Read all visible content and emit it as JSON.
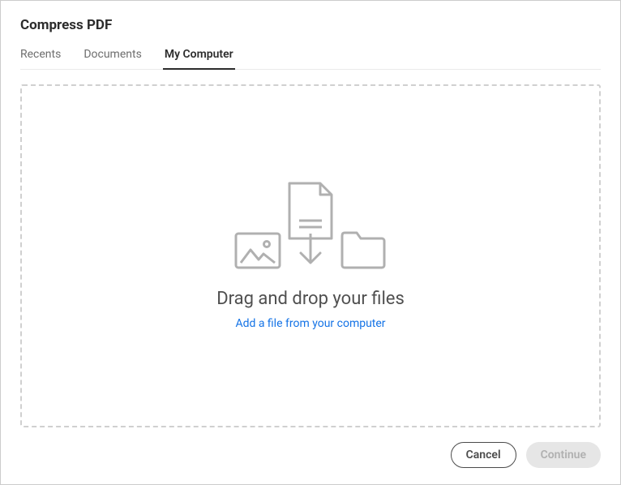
{
  "title": "Compress PDF",
  "tabs": {
    "recents": "Recents",
    "documents": "Documents",
    "mycomputer": "My Computer"
  },
  "dropzone": {
    "heading": "Drag and drop your files",
    "addLink": "Add a file from your computer"
  },
  "buttons": {
    "cancel": "Cancel",
    "continue": "Continue"
  }
}
